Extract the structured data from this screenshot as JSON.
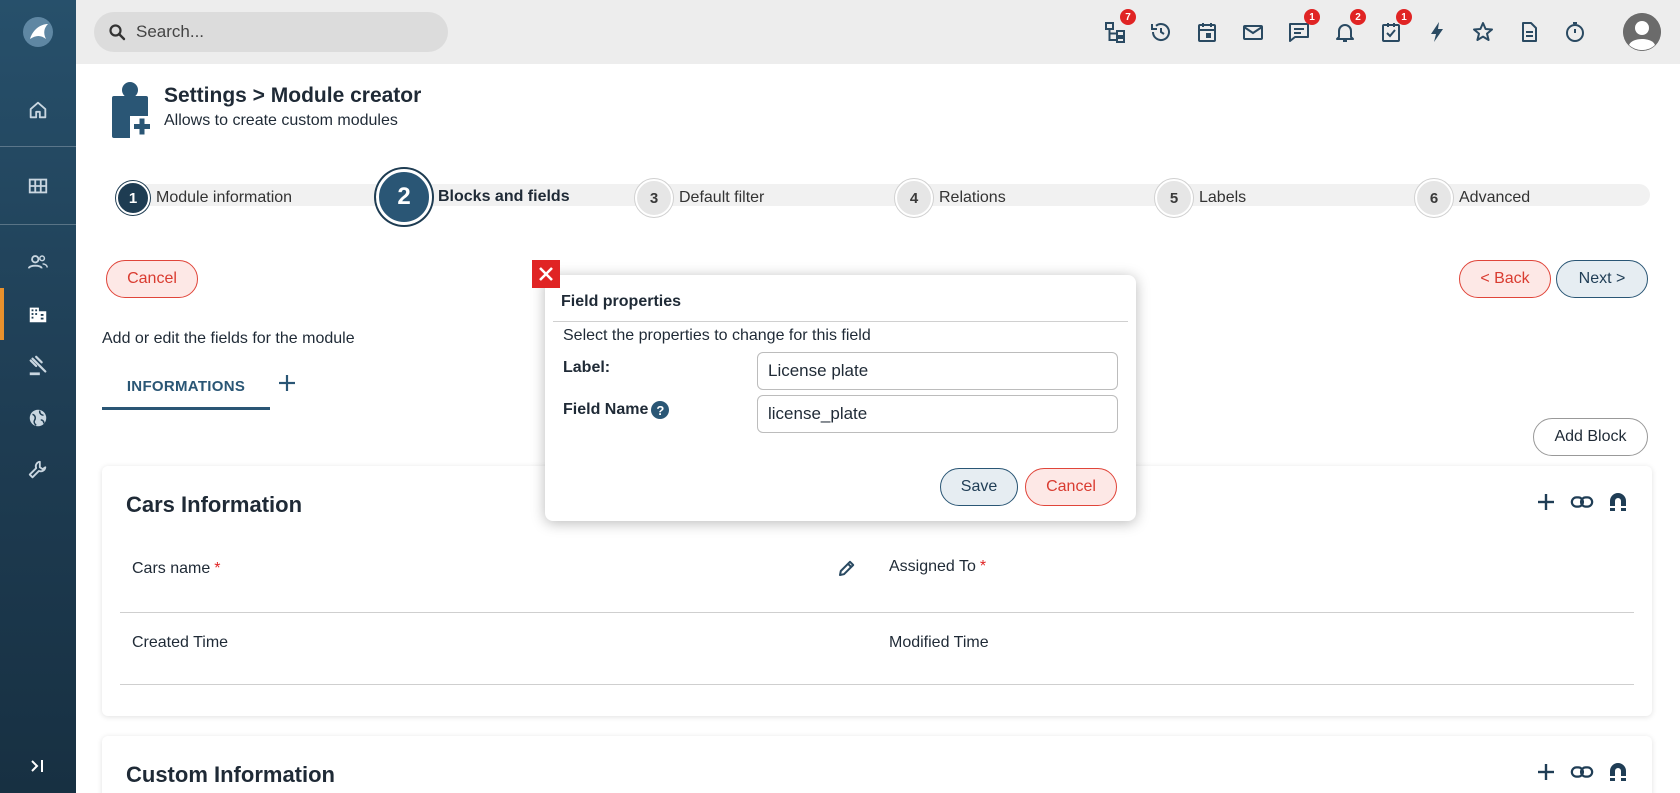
{
  "search": {
    "placeholder": "Search..."
  },
  "topbar": {
    "icons": [
      {
        "name": "hierarchy-icon",
        "badge": "7"
      },
      {
        "name": "history-icon",
        "badge": ""
      },
      {
        "name": "calendar-icon",
        "badge": ""
      },
      {
        "name": "mail-icon",
        "badge": ""
      },
      {
        "name": "chat-icon",
        "badge": "1"
      },
      {
        "name": "bell-icon",
        "badge": "2"
      },
      {
        "name": "task-icon",
        "badge": "1"
      },
      {
        "name": "lightning-icon",
        "badge": ""
      },
      {
        "name": "star-icon",
        "badge": ""
      },
      {
        "name": "document-icon",
        "badge": ""
      },
      {
        "name": "timer-icon",
        "badge": ""
      }
    ]
  },
  "header": {
    "title": "Settings > Module creator",
    "subtitle": "Allows to create custom modules"
  },
  "steps": [
    {
      "num": "1",
      "label": "Module information",
      "state": "done"
    },
    {
      "num": "2",
      "label": "Blocks and fields",
      "state": "current"
    },
    {
      "num": "3",
      "label": "Default filter",
      "state": "todo"
    },
    {
      "num": "4",
      "label": "Relations",
      "state": "todo"
    },
    {
      "num": "5",
      "label": "Labels",
      "state": "todo"
    },
    {
      "num": "6",
      "label": "Advanced",
      "state": "todo"
    }
  ],
  "actions": {
    "cancel": "Cancel",
    "back": "< Back",
    "next": "Next >",
    "add_block": "Add Block"
  },
  "instruction": "Add or edit the fields for the module",
  "tabs": [
    {
      "label": "INFORMATIONS"
    }
  ],
  "blocks": [
    {
      "title": "Cars Information",
      "fields": [
        {
          "label": "Cars name",
          "required": "*"
        },
        {
          "label": "Assigned To",
          "required": "*"
        },
        {
          "label": "Created Time",
          "required": ""
        },
        {
          "label": "Modified Time",
          "required": ""
        }
      ]
    },
    {
      "title": "Custom Information"
    }
  ],
  "modal": {
    "title": "Field properties",
    "description": "Select the properties to change for this field",
    "label_caption": "Label:",
    "label_value": "License plate",
    "fieldname_caption": "Field Name",
    "fieldname_value": "license_plate",
    "help": "?",
    "save": "Save",
    "cancel": "Cancel"
  },
  "colors": {
    "sidebar": "#1e3c52",
    "accent": "#2a5675",
    "active_indicator": "#e8912d",
    "danger": "#e02424"
  }
}
